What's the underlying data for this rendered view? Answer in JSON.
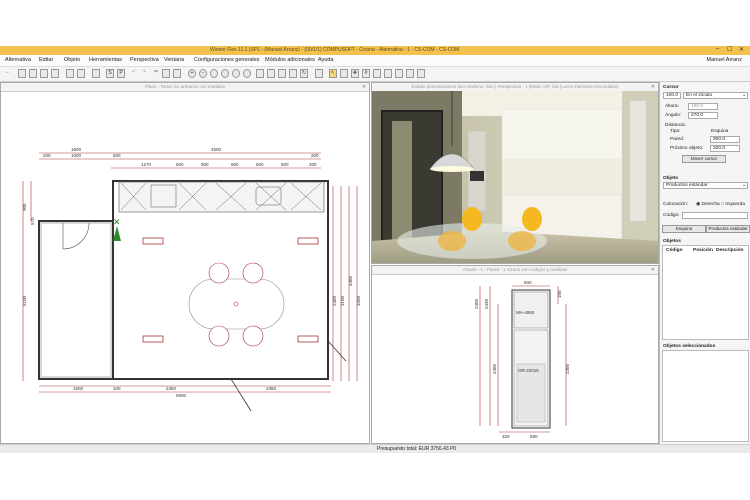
{
  "window": {
    "title": "Winner Flex 11.1 (SP1 - (Manuel Arranz) - (00/1/1) COMPUSOFT - Cocina - Alternativa - 1 - CS-COM - CS-COM",
    "min": "–",
    "max": "☐",
    "close": "✕"
  },
  "menu": [
    "Alternativa",
    "Editar",
    "Objeto",
    "Herramientas",
    "Perspectiva",
    "Ventana",
    "Configuraciones generales",
    "Módulos adicionales",
    "Ayuda"
  ],
  "user": "Manuel Arranz",
  "plan": {
    "header": "Plano - Todos los armarios con medidas",
    "dims_top": [
      "1500",
      "4500"
    ],
    "dims_row2": [
      "200",
      "1000",
      "600",
      "200"
    ],
    "dims_row3": [
      "1270",
      "600",
      "900",
      "600",
      "600",
      "600",
      "200"
    ],
    "dims_left": [
      "900",
      "570",
      "5100"
    ],
    "dims_right": [
      "2400",
      "3100",
      "4400",
      "3300"
    ],
    "dims_bottom": [
      "1500",
      "100",
      "2350",
      "2350",
      "5900"
    ]
  },
  "render": {
    "header": "Estado procesamiento foto realismo: listo | Perspectiva - 1 (Modo VR) Sia (Luces interiores encendidas)"
  },
  "elev": {
    "header": "Alzado - 1 - Pared - 1 Alzado con códigos y medidas",
    "dim_width": "600",
    "dim_h_left": [
      "2400",
      "2430",
      "2400"
    ],
    "dim_h_right": [
      "100",
      "2300"
    ],
    "code_top": "MA-4060",
    "code_bottom": "OR-22015",
    "dim_bottom": [
      "320",
      "580"
    ]
  },
  "panel": {
    "cursor_title": "Cursor",
    "cursor_value": "100.0",
    "cursor_mode": "En el zócalo",
    "altura_label": "Altura:",
    "altura_value": "100.0",
    "angulo_label": "Ángulo:",
    "angulo_value": "270.0",
    "distancia_title": "Distancia:",
    "tipo_label": "Tipo:",
    "tipo_value": "Esquina",
    "pared_label": "Pared:",
    "pared_value": "900.0",
    "proximo_label": "Próximo objeto:",
    "proximo_value": "320.0",
    "mover_cursor": "Mover cursor",
    "objeto_title": "Objeto",
    "objeto_value": "Productos estándar",
    "colocacion_label": "Colocación:",
    "derecha": "Derecha",
    "izquierda": "Izquierda",
    "codigo_label": "Código:",
    "esquina_btn": "Esquina",
    "productos_btn": "Productos estándar",
    "objetos_title": "Objetos",
    "col_codigo": "Código",
    "col_posicion": "Posición",
    "col_descripcion": "Descripción",
    "seleccionados_title": "Objetos seleccionados"
  },
  "status": {
    "presupuesto": "Presupuesto total: EUR 3756.43  P0"
  }
}
